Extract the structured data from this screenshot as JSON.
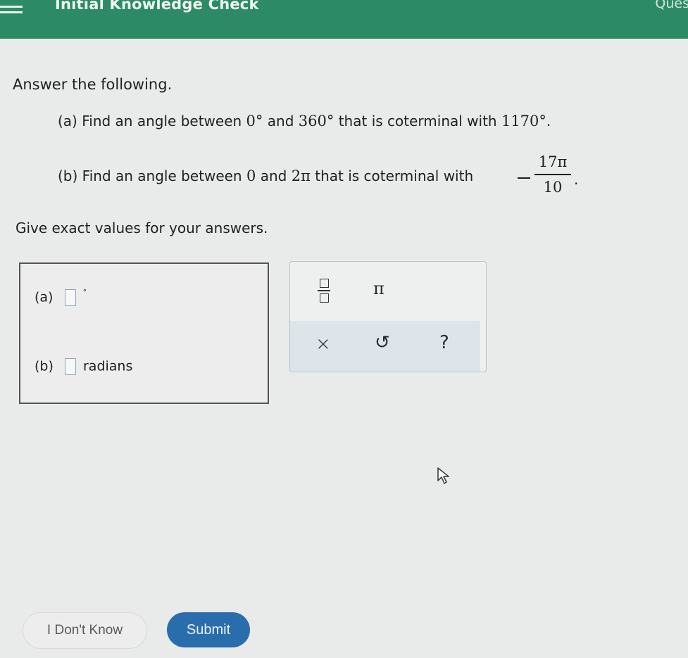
{
  "header": {
    "title": "Initial Knowledge Check",
    "right_text": "Ques"
  },
  "question": {
    "prompt": "Answer the following.",
    "part_a": {
      "label": "(a) Find an angle between",
      "val1": "0°",
      "word_and": "and",
      "val2": "360°",
      "tail": "that is coterminal with",
      "target": "1170°",
      "end": "."
    },
    "part_b": {
      "label": "(b) Find an angle between",
      "val1": "0",
      "word_and": "and",
      "val2": "2π",
      "tail": "that is coterminal with",
      "numerator": "17π",
      "denominator": "10",
      "end": "."
    },
    "instructions": "Give exact values for your answers."
  },
  "answers": {
    "a_label": "(a)",
    "a_unit": "°",
    "b_label": "(b)",
    "b_unit": "radians"
  },
  "keypad": {
    "pi": "π",
    "clear": "×",
    "undo": "↺",
    "help": "?"
  },
  "buttons": {
    "dont_know": "I Don't Know",
    "submit": "Submit"
  }
}
